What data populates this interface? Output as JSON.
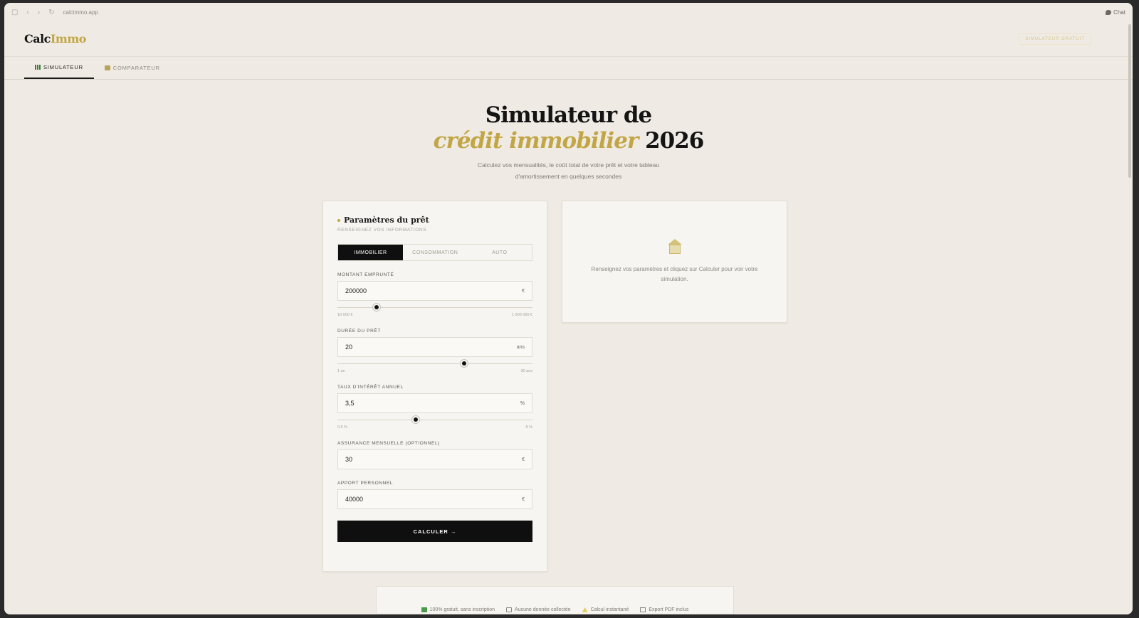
{
  "browser": {
    "url": "calcimmo.app",
    "chat_label": "Chat"
  },
  "header": {
    "logo_a": "Calc",
    "logo_b": "Immo",
    "cta": "SIMULATEUR GRATUIT"
  },
  "tabs": [
    {
      "label": "SIMULATEUR",
      "icon": "bar-chart-icon"
    },
    {
      "label": "COMPARATEUR",
      "icon": "scale-icon"
    }
  ],
  "hero": {
    "title_line1": "Simulateur de",
    "title_em": "crédit immobilier",
    "title_year": "2026",
    "subtitle_1": "Calculez vos mensualités, le coût total de votre prêt et votre tableau",
    "subtitle_2": "d'amortissement en quelques secondes"
  },
  "form": {
    "title": "Paramètres du prêt",
    "subtitle": "RENSEIGNEZ VOS INFORMATIONS",
    "loan_types": [
      "IMMOBILIER",
      "CONSOMMATION",
      "AUTO"
    ],
    "amount": {
      "label": "MONTANT EMPRUNTÉ",
      "value": "200000",
      "unit": "€",
      "min_label": "10 000 €",
      "max_label": "1 000 000 €",
      "slider_fraction": 0.2
    },
    "duration": {
      "label": "DURÉE DU PRÊT",
      "value": "20",
      "unit": "ans",
      "min_label": "1 an",
      "max_label": "30 ans",
      "slider_fraction": 0.65
    },
    "rate": {
      "label": "TAUX D'INTÉRÊT ANNUEL",
      "value": "3,5",
      "unit": "%",
      "min_label": "0,5 %",
      "max_label": "8 %",
      "slider_fraction": 0.4
    },
    "insurance": {
      "label": "ASSURANCE MENSUELLE (OPTIONNEL)",
      "value": "30",
      "unit": "€"
    },
    "down_payment": {
      "label": "APPORT PERSONNEL",
      "value": "40000",
      "unit": "€"
    },
    "submit": "CALCULER →"
  },
  "result": {
    "icon": "bank-icon",
    "text": "Renseignez vos paramètres et cliquez sur Calculer pour voir votre simulation."
  },
  "features": [
    "100% gratuit, sans inscription",
    "Aucune donnée collectée",
    "Calcul instantané",
    "Export PDF inclus"
  ],
  "colors": {
    "accent": "#c2a646",
    "dark": "#0f0f0f",
    "background": "#efebe4"
  }
}
